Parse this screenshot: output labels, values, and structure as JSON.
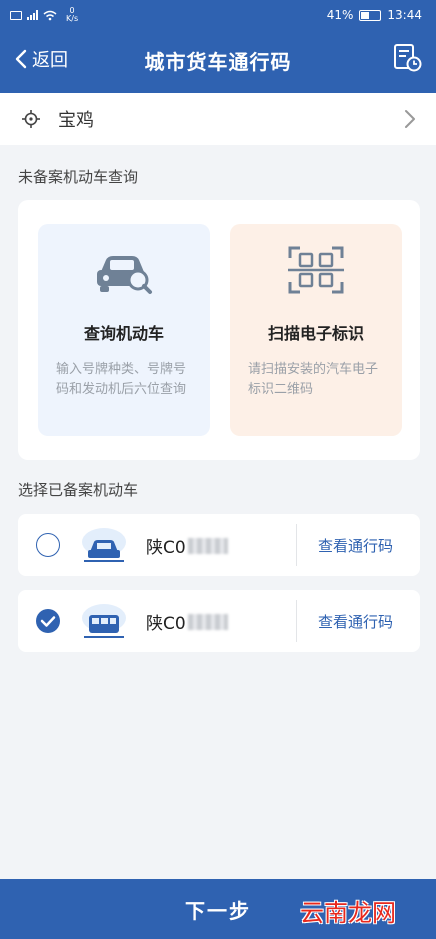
{
  "status_bar": {
    "speed_value": "0",
    "speed_unit": "K/s",
    "battery": "41%",
    "time": "13:44"
  },
  "nav": {
    "back_label": "返回",
    "title": "城市货车通行码"
  },
  "city": {
    "name": "宝鸡"
  },
  "unregistered_section": {
    "label": "未备案机动车查询",
    "options": [
      {
        "title": "查询机动车",
        "desc": "输入号牌种类、号牌号码和发动机后六位查询"
      },
      {
        "title": "扫描电子标识",
        "desc": "请扫描安装的汽车电子标识二维码"
      }
    ]
  },
  "registered_section": {
    "label": "选择已备案机动车",
    "vehicles": [
      {
        "plate": "陕C0",
        "action": "查看通行码",
        "selected": false
      },
      {
        "plate": "陕C0",
        "action": "查看通行码",
        "selected": true
      }
    ]
  },
  "footer": {
    "next_label": "下一步",
    "watermark": "云南龙网"
  },
  "colors": {
    "primary": "#2f62b1",
    "background": "#f2f4f7",
    "scan_card": "#fdf0e7",
    "query_card": "#eef4fd"
  }
}
